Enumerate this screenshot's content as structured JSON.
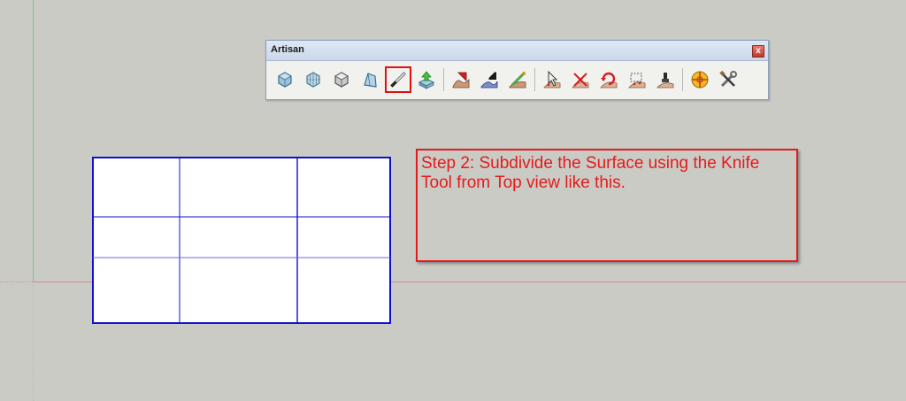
{
  "toolbar": {
    "title": "Artisan",
    "close_label": "x",
    "tools": [
      {
        "name": "subdivide-smooth-icon"
      },
      {
        "name": "subdivide-icon"
      },
      {
        "name": "smooth-icon"
      },
      {
        "name": "crease-icon"
      },
      {
        "name": "knife-tool-icon",
        "selected": true
      },
      {
        "name": "extrude-icon"
      },
      {
        "name": "sculpt-add-icon"
      },
      {
        "name": "sculpt-push-icon"
      },
      {
        "name": "sculpt-smooth-icon"
      },
      {
        "name": "select-vertices-icon"
      },
      {
        "name": "scale-vertices-icon"
      },
      {
        "name": "rotate-vertices-icon"
      },
      {
        "name": "soft-select-icon"
      },
      {
        "name": "paint-select-icon"
      },
      {
        "name": "organizer-icon"
      },
      {
        "name": "settings-tools-icon"
      }
    ]
  },
  "note": {
    "text": "Step 2: Subdivide the Surface using the Knife Tool from Top view like this.",
    "color": "#e31b1b"
  },
  "colors": {
    "grid_edge": "#1010d0",
    "axis_red": "#d88a8a",
    "axis_green": "#7cc47c",
    "background": "#cbcbc6"
  }
}
